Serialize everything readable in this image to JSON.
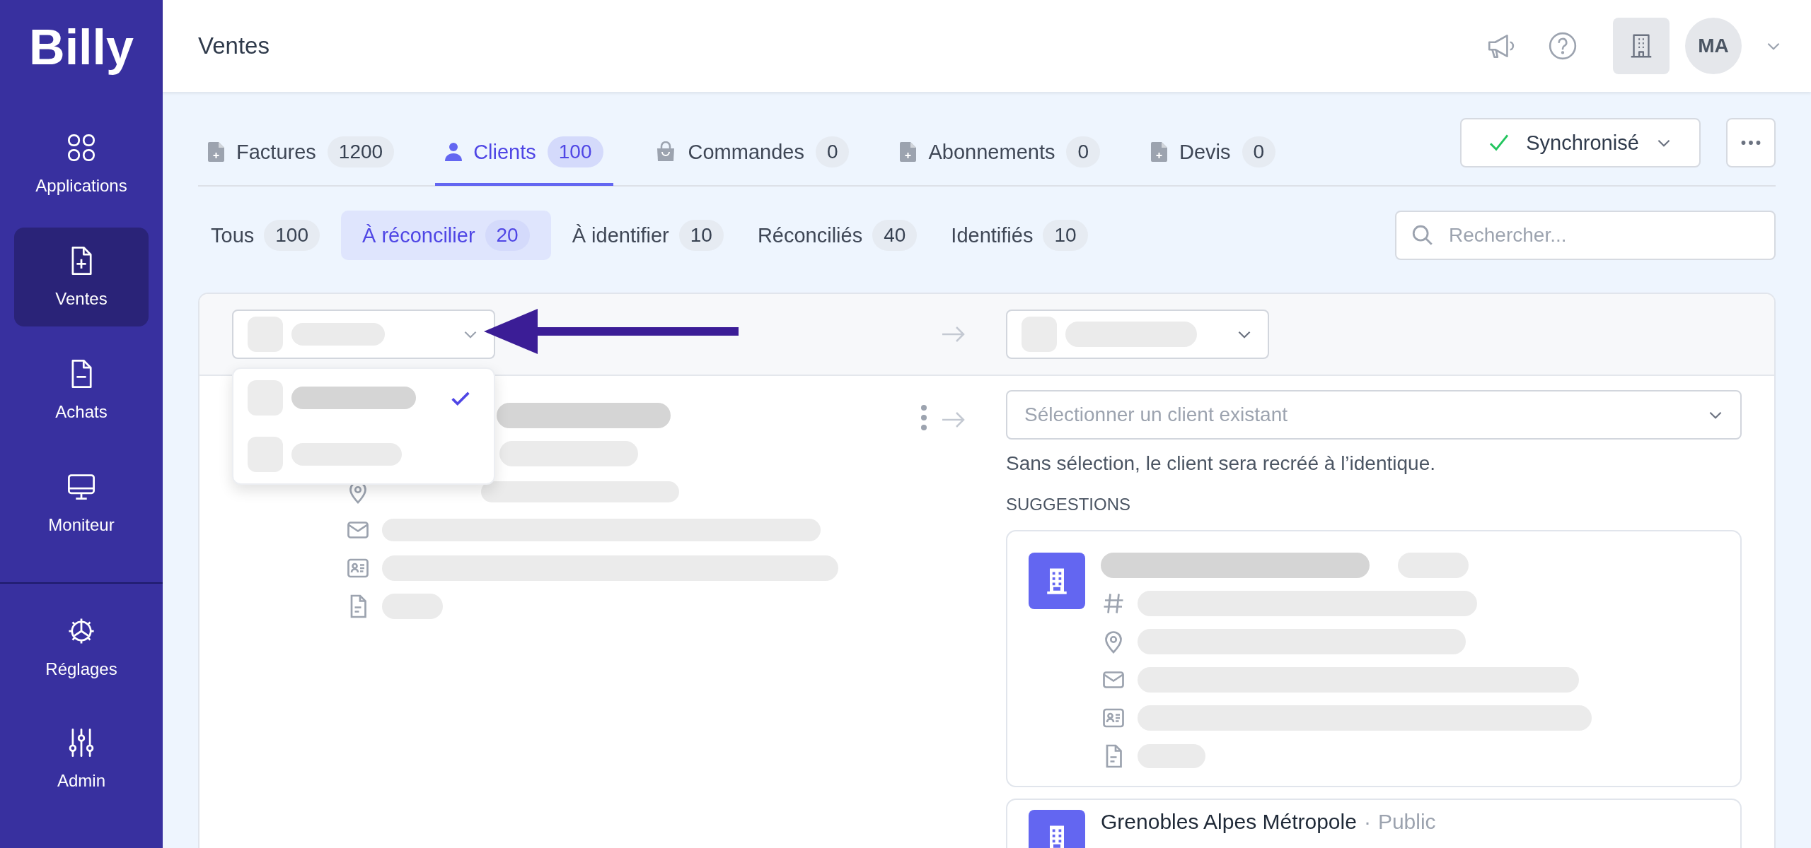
{
  "sidebar": {
    "logo": "Billy",
    "items": [
      {
        "label": "Applications",
        "kind": "grid",
        "selected": false
      },
      {
        "label": "Ventes",
        "kind": "doc-plus",
        "selected": true
      },
      {
        "label": "Achats",
        "kind": "doc-minus",
        "selected": false
      },
      {
        "label": "Moniteur",
        "kind": "monitor",
        "selected": false
      }
    ],
    "bottom_items": [
      {
        "label": "Réglages",
        "kind": "gear",
        "selected": false
      },
      {
        "label": "Admin",
        "kind": "sliders",
        "selected": false
      }
    ]
  },
  "header": {
    "title": "Ventes",
    "avatar": "MA"
  },
  "tabs": [
    {
      "label": "Factures",
      "count": "1200",
      "kind": "doc",
      "selected": false
    },
    {
      "label": "Clients",
      "count": "100",
      "kind": "person",
      "selected": true
    },
    {
      "label": "Commandes",
      "count": "0",
      "kind": "bag",
      "selected": false
    },
    {
      "label": "Abonnements",
      "count": "0",
      "kind": "doc",
      "selected": false
    },
    {
      "label": "Devis",
      "count": "0",
      "kind": "doc",
      "selected": false
    }
  ],
  "sync_button": {
    "label": "Synchronisé"
  },
  "filters": [
    {
      "label": "Tous",
      "count": "100",
      "selected": false
    },
    {
      "label": "À réconcilier",
      "count": "20",
      "selected": true
    },
    {
      "label": "À identifier",
      "count": "10",
      "selected": false
    },
    {
      "label": "Réconciliés",
      "count": "40",
      "selected": false
    },
    {
      "label": "Identifiés",
      "count": "10",
      "selected": false
    }
  ],
  "search": {
    "placeholder": "Rechercher..."
  },
  "source_menu": {
    "options": [
      {
        "selected": true
      },
      {
        "selected": false
      }
    ]
  },
  "client_select": {
    "placeholder": "Sélectionner un client existant"
  },
  "helper_text": "Sans sélection, le client sera recréé à l’identique.",
  "suggestions_heading": "SUGGESTIONS",
  "suggestions": [
    {
      "kind": "redacted"
    },
    {
      "kind": "named",
      "name": "Grenobles Alpes Métropole",
      "separator": "·",
      "type": "Public"
    }
  ]
}
